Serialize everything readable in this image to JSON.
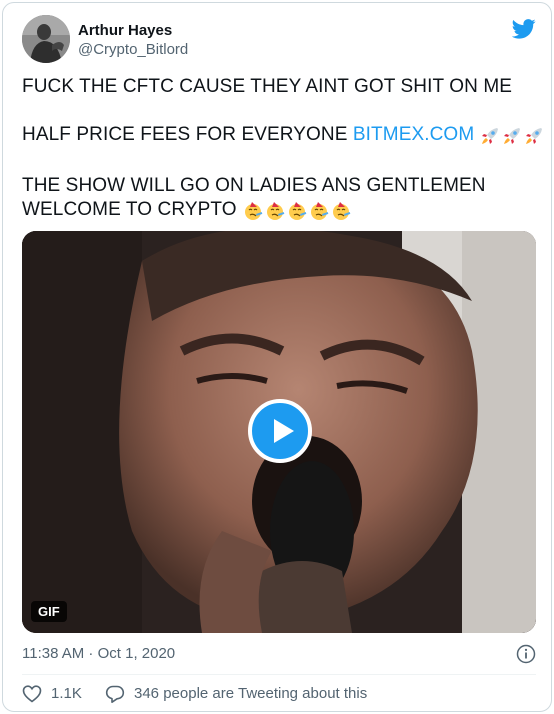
{
  "author": {
    "display_name": "Arthur Hayes",
    "handle": "@Crypto_Bitlord"
  },
  "tweet": {
    "line1": "FUCK THE CFTC CAUSE THEY AINT GOT SHIT ON ME",
    "line2_text": "HALF PRICE FEES FOR EVERYONE ",
    "line2_link": "BITMEX.COM",
    "line2_emoji": "rocket-emoji",
    "line2_emoji_count": 3,
    "line3": "THE SHOW WILL GO ON LADIES ANS GENTLEMEN",
    "line4": "WELCOME TO CRYPTO",
    "line4_emoji": "partying-face-emoji",
    "line4_emoji_count": 5
  },
  "media": {
    "badge": "GIF",
    "type": "animated-gif",
    "play_icon": "play-icon"
  },
  "meta": {
    "timestamp": "11:38 AM · Oct 1, 2020",
    "info_icon": "info-icon"
  },
  "actions": {
    "likes": "1.1K",
    "reply_text": "346 people are Tweeting about this"
  },
  "colors": {
    "link": "#1d9bf0",
    "secondary_text": "#536471",
    "play_button": "#1d9bf0",
    "like_icon": "#536471",
    "border": "#cfd9de"
  }
}
